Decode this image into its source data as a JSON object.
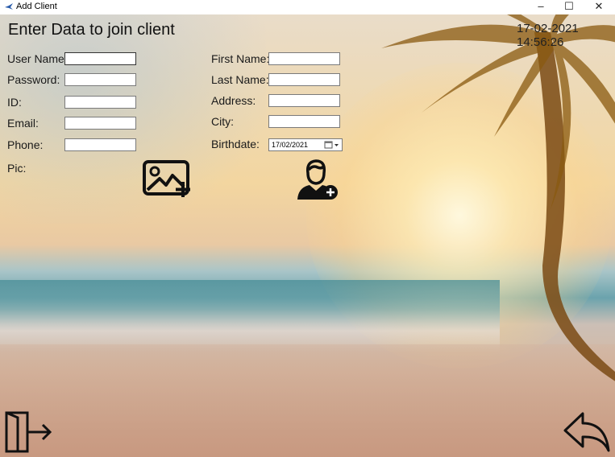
{
  "window": {
    "title": "Add Client",
    "min_glyph": "–",
    "max_glyph": "☐",
    "close_glyph": "✕"
  },
  "header": {
    "heading": "Enter Data to join client",
    "datetime": "17-02-2021 14:56:26"
  },
  "left_form": {
    "username_label": "User Name:",
    "password_label": "Password:",
    "id_label": "ID:",
    "email_label": "Email:",
    "phone_label": "Phone:",
    "pic_label": "Pic:"
  },
  "right_form": {
    "firstname_label": "First Name:",
    "lastname_label": "Last Name:",
    "address_label": "Address:",
    "city_label": "City:",
    "birthdate_label": "Birthdate:",
    "birthdate_value": "17/02/2021"
  },
  "icons": {
    "add_image": "add-image-icon",
    "add_user": "add-user-icon",
    "exit": "exit-door-icon",
    "back": "back-arrow-icon"
  }
}
